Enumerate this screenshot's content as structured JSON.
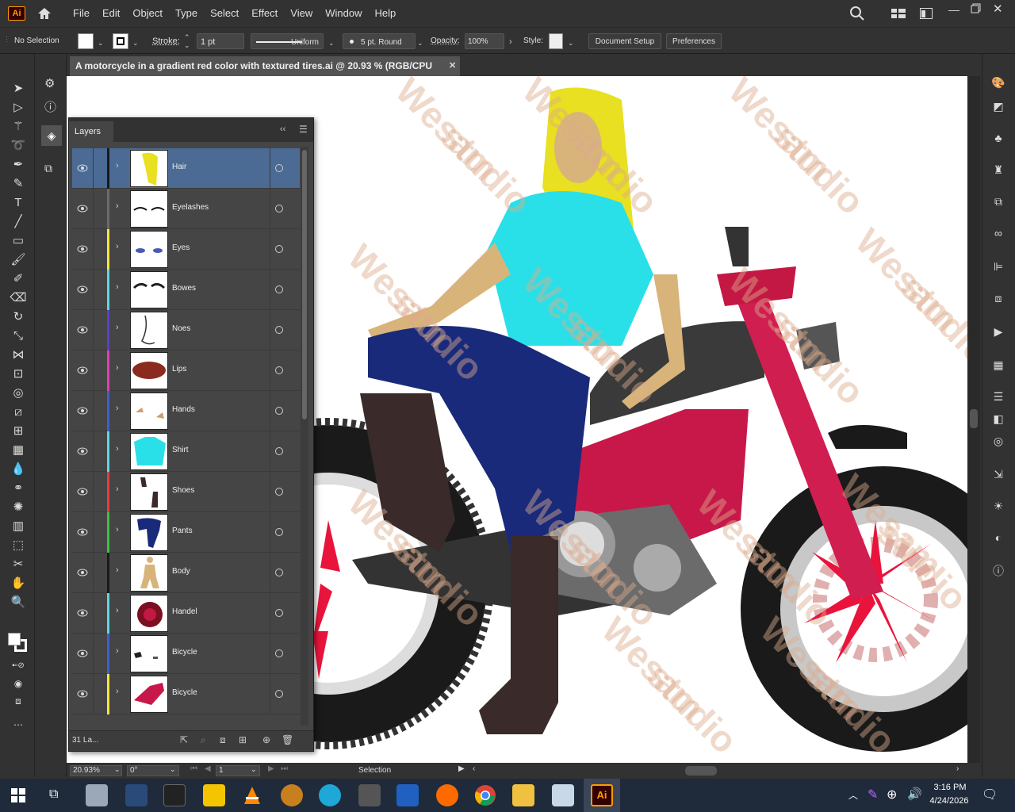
{
  "app": {
    "logo": "Ai",
    "menu": [
      "File",
      "Edit",
      "Object",
      "Type",
      "Select",
      "Effect",
      "View",
      "Window",
      "Help"
    ]
  },
  "control_bar": {
    "selection_status": "No Selection",
    "stroke_label": "Stroke:",
    "stroke_weight": "1 pt",
    "stroke_profile": "Uniform",
    "brush": "5 pt. Round",
    "opacity_label": "Opacity:",
    "opacity_value": "100%",
    "style_label": "Style:",
    "document_setup": "Document Setup",
    "preferences": "Preferences"
  },
  "document": {
    "tab_title": "A motorcycle in a gradient red color with textured tires.ai @ 20.93 % (RGB/CPU Preview)",
    "watermark_text": "Wesam studio"
  },
  "layers_panel": {
    "title": "Layers",
    "layer_count": "31 La...",
    "layers": [
      {
        "name": "Hair",
        "color": "#1a1a1a",
        "selected": true
      },
      {
        "name": "Eyelashes",
        "color": "#6b6b6b",
        "selected": false
      },
      {
        "name": "Eyes",
        "color": "#f5e642",
        "selected": false
      },
      {
        "name": "Bowes",
        "color": "#5fd7e0",
        "selected": false
      },
      {
        "name": "Noes",
        "color": "#5b3fc7",
        "selected": false
      },
      {
        "name": "Lips",
        "color": "#e040b0",
        "selected": false
      },
      {
        "name": "Hands",
        "color": "#3f5fd0",
        "selected": false
      },
      {
        "name": "Shirt",
        "color": "#5fd7e0",
        "selected": false
      },
      {
        "name": "Shoes",
        "color": "#e04040",
        "selected": false
      },
      {
        "name": "Pants",
        "color": "#40c040",
        "selected": false
      },
      {
        "name": "Body",
        "color": "#1a1a1a",
        "selected": false
      },
      {
        "name": "Handel",
        "color": "#5fd7e0",
        "selected": false
      },
      {
        "name": "Bicycle",
        "color": "#3f5fd0",
        "selected": false
      },
      {
        "name": "Bicycle",
        "color": "#f5e642",
        "selected": false
      }
    ]
  },
  "status_bar": {
    "zoom": "20.93%",
    "rotation": "0°",
    "artboard": "1",
    "tool": "Selection"
  },
  "taskbar": {
    "time": "3:16 PM",
    "date": "4/24/2026"
  }
}
